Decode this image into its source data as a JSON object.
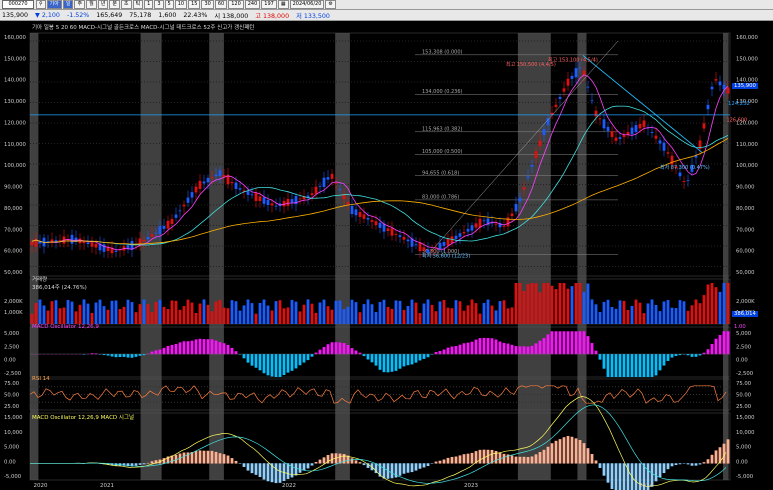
{
  "toolbar": {
    "code": "000270",
    "company": "기아",
    "period_label": "일",
    "buttons": [
      "일",
      "주",
      "월",
      "년",
      "분",
      "초",
      "틱",
      "1",
      "3",
      "5",
      "10",
      "15",
      "30",
      "60",
      "120",
      "240"
    ],
    "count": "197",
    "date": "2024/06/20"
  },
  "quote": {
    "price": "135,900",
    "change": "2,100",
    "change_pct": "-1.52%",
    "volume": "165,649",
    "amount": "75,178",
    "amount_unit": "1,600",
    "ratio": "22.43%",
    "open": "138,000",
    "high": "138,000",
    "low": "133,500",
    "labels": {
      "open": "시",
      "high": "고",
      "low": "저",
      "price": "현재"
    }
  },
  "price_panel": {
    "legend": "기아 일봉  5  20  60  MACD-시그널 골든크로스  MACD-시그널 데드크로스  52주 신고가 갱신패턴",
    "current_tag": "135,900",
    "hline_tag": "124,232",
    "y_labels": [
      "160,000",
      "150,000",
      "140,000",
      "130,000",
      "120,000",
      "110,000",
      "100,000",
      "90,000",
      "80,000",
      "70,000",
      "60,000",
      "50,000"
    ],
    "fib_labels": [
      "153,308 (0.000)",
      "134,000 (0.236)",
      "115,963 (0.382)",
      "105,000 (0.500)",
      "94,655 (0.618)",
      "83,000 (0.786)",
      "56,500 (1.000)"
    ],
    "annotations": [
      "최고 150,500 (4,4/5)",
      "최저 87,300 (0.47%)",
      "최고 153,100 (4,5/4)",
      "최저 56,600 (12/23)",
      "126,600"
    ]
  },
  "volume_panel": {
    "legend": "거래량",
    "value": "386,014주 (24.76%)",
    "tag": "386,014",
    "y_labels": [
      "2,000K",
      "1,000K"
    ]
  },
  "osc_panel": {
    "legend": "MACD Oscillator 12,26,9",
    "tag": "1.00",
    "y_labels": [
      "5,000",
      "2,500",
      "0.00",
      "-2,500"
    ]
  },
  "rsi_panel": {
    "legend": "RSI 14",
    "y_labels": [
      "75.00",
      "50.00",
      "25.00"
    ]
  },
  "macd_panel": {
    "legend": "MACD Oscillator 12,26,9   MACD   시그널",
    "y_labels": [
      "15,000",
      "10,000",
      "5,000",
      "0.00",
      "-5,000"
    ]
  },
  "x_labels": [
    "2020",
    "2021",
    "2022",
    "2023",
    "2024"
  ],
  "colors": {
    "up": "#e01010",
    "down": "#1a5cff",
    "ma5": "#ff40ff",
    "ma20": "#40e0e0",
    "ma60": "#ffb000",
    "osc_pos": "#ff10ff",
    "osc_neg": "#00c0ff",
    "shade": "#555555",
    "hline": "#20a0ff"
  }
}
